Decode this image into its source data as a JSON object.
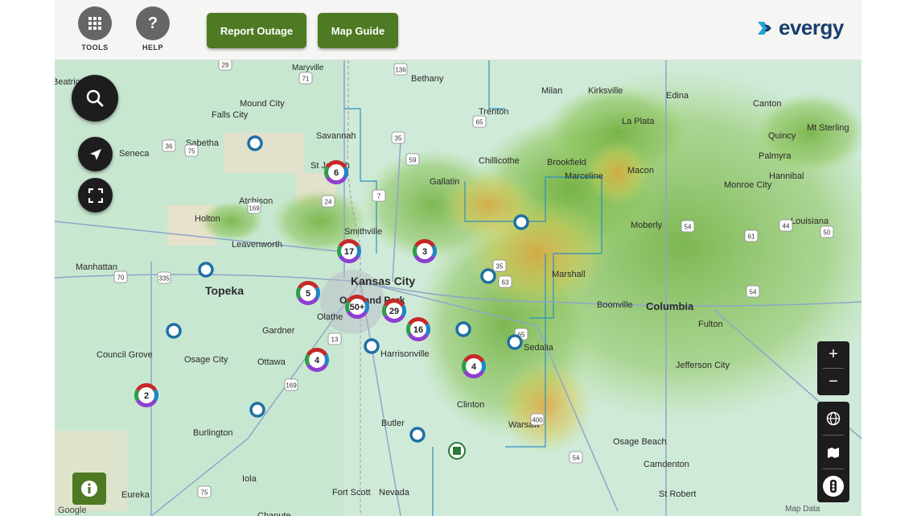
{
  "header": {
    "tools_label": "TOOLS",
    "help_label": "HELP",
    "report_outage_label": "Report Outage",
    "map_guide_label": "Map Guide",
    "logo_text": "evergy",
    "colors": {
      "button_green": "#4e7a23",
      "logo_blue": "#1a3d6d"
    }
  },
  "map": {
    "cities": [
      {
        "name": "Maryville"
      },
      {
        "name": "Bethany"
      },
      {
        "name": "Beatrice"
      },
      {
        "name": "Falls City"
      },
      {
        "name": "Mound City"
      },
      {
        "name": "Milan"
      },
      {
        "name": "Kirksville"
      },
      {
        "name": "Edina"
      },
      {
        "name": "Canton"
      },
      {
        "name": "Trenton"
      },
      {
        "name": "La Plata"
      },
      {
        "name": "Mt Sterling"
      },
      {
        "name": "Savannah"
      },
      {
        "name": "Quincy"
      },
      {
        "name": "Sabetha"
      },
      {
        "name": "Seneca"
      },
      {
        "name": "Chillicothe"
      },
      {
        "name": "Brookfield"
      },
      {
        "name": "Palmyra"
      },
      {
        "name": "St Joseph"
      },
      {
        "name": "Gallatin"
      },
      {
        "name": "Marceline"
      },
      {
        "name": "Macon"
      },
      {
        "name": "Hannibal"
      },
      {
        "name": "Atchison"
      },
      {
        "name": "Monroe City"
      },
      {
        "name": "Holton"
      },
      {
        "name": "Smithville"
      },
      {
        "name": "Moberly"
      },
      {
        "name": "Louisiana"
      },
      {
        "name": "Leavenworth"
      },
      {
        "name": "Manhattan"
      },
      {
        "name": "Kansas City"
      },
      {
        "name": "Marshall"
      },
      {
        "name": "Topeka"
      },
      {
        "name": "Overland Park"
      },
      {
        "name": "Boonville"
      },
      {
        "name": "Columbia"
      },
      {
        "name": "Olathe"
      },
      {
        "name": "Fulton"
      },
      {
        "name": "Gardner"
      },
      {
        "name": "Sedalia"
      },
      {
        "name": "Council Grove"
      },
      {
        "name": "Osage City"
      },
      {
        "name": "Ottawa"
      },
      {
        "name": "Harrisonville"
      },
      {
        "name": "Jefferson City"
      },
      {
        "name": "Clinton"
      },
      {
        "name": "Butler"
      },
      {
        "name": "Warsaw"
      },
      {
        "name": "Burlington"
      },
      {
        "name": "Osage Beach"
      },
      {
        "name": "Camdenton"
      },
      {
        "name": "Iola"
      },
      {
        "name": "Eureka"
      },
      {
        "name": "Fort Scott"
      },
      {
        "name": "Nevada"
      },
      {
        "name": "St Robert"
      },
      {
        "name": "Chanute"
      }
    ],
    "highways": [
      "29",
      "71",
      "136",
      "65",
      "36",
      "75",
      "35",
      "59",
      "169",
      "24",
      "70",
      "335",
      "63",
      "54",
      "61",
      "50",
      "35",
      "7",
      "13",
      "65",
      "54",
      "44",
      "400",
      "75",
      "169",
      "54"
    ],
    "outage_clusters": [
      {
        "count": "6"
      },
      {
        "count": "17"
      },
      {
        "count": "3"
      },
      {
        "count": "5"
      },
      {
        "count": "50+"
      },
      {
        "count": "29"
      },
      {
        "count": "16"
      },
      {
        "count": "4"
      },
      {
        "count": "4"
      },
      {
        "count": "2"
      }
    ],
    "google_label": "Google",
    "attribution": "Map Data"
  },
  "controls": {
    "zoom_in": "+",
    "zoom_out": "−"
  }
}
